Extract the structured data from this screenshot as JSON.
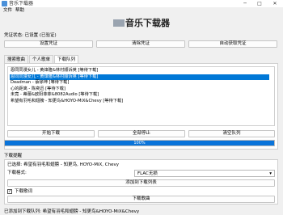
{
  "window": {
    "title": "音乐下载器",
    "minimize_glyph": "─",
    "maximize_glyph": "□",
    "close_glyph": "✕"
  },
  "menu": [
    "文件",
    "帮助"
  ],
  "heading": "音乐下载器",
  "credential": {
    "status_text": "凭证状态: 已设置 (已验证)",
    "set_button": "设置凭证",
    "clear_button": "清除凭证",
    "auto_button": "自动获取凭证"
  },
  "tabs": [
    "搜索歌曲",
    "个人歌单",
    "下载队列"
  ],
  "active_tab": 2,
  "queue": [
    "恩同同漫女儿 - 黄烽隆&林村顺诉英 [等待下载]",
    "恩同同漫女儿 - 黄烽隆&林村顺诉英 [等待下载]",
    "Deadman - 蔡徐坤 [等待下载]",
    "心的距离 - 陈奕迅 [等待下载]",
    "未竟 - 蒂蕾&欧阳菲菲&8082Audio [等待下载]",
    "希望有羽毛和翅膀 - 知更鸟&HOYO-MiX&Chevy [等待下载]"
  ],
  "selected_row": 1,
  "queue_buttons": {
    "start": "开始下载",
    "stop": "全部停止",
    "clear": "清空队列"
  },
  "progress": {
    "value": 1.0,
    "label": "100%"
  },
  "download_settings": {
    "section_label": "下载提醒",
    "selected_text": "已选择: 希望有羽毛和翅膀 - 知更鸟, HOYO-MiX, Chevy",
    "format_label": "下载格式:",
    "format_value": "FLAC无损",
    "add_button": "添加到下载列表",
    "lyrics_label": "下载歌词",
    "lyrics_checked": true,
    "download_lyrics_button": "下载歌曲"
  },
  "status_bar": "已添加到下载队列: 希望有羽毛和翅膀 - 知更鸟&HOYO-MiX&Chevy"
}
